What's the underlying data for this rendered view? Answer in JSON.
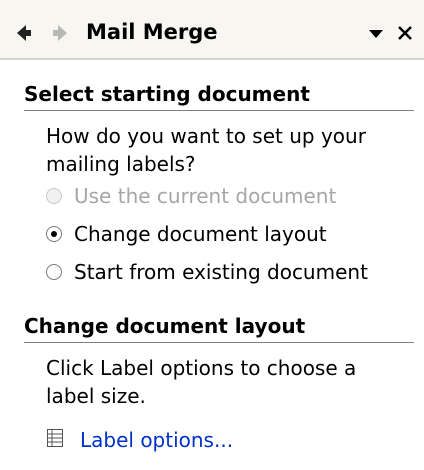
{
  "pane": {
    "title": "Mail Merge",
    "icons": {
      "back": "back-arrow-icon",
      "forward": "forward-arrow-icon",
      "menu": "chevron-down-icon",
      "close": "close-icon"
    }
  },
  "section1": {
    "heading": "Select starting document",
    "prompt": "How do you want to set up your mailing labels?",
    "options": [
      {
        "label": "Use the current document",
        "selected": false,
        "disabled": true
      },
      {
        "label": "Change document layout",
        "selected": true,
        "disabled": false
      },
      {
        "label": "Start from existing document",
        "selected": false,
        "disabled": false
      }
    ]
  },
  "section2": {
    "heading": "Change document layout",
    "instructions": "Click Label options to choose a label size.",
    "link_label": "Label options..."
  },
  "colors": {
    "link": "#0032c8",
    "pane_background": "#f7f6f1"
  }
}
